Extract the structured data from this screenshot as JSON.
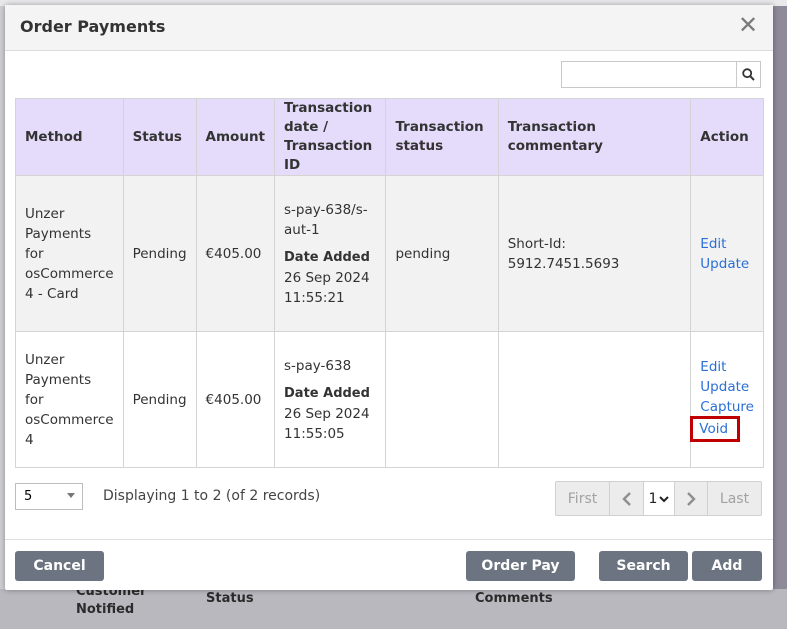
{
  "background": {
    "bottom_columns": [
      "Customer Notified",
      "Status",
      "Comments"
    ]
  },
  "modal": {
    "title": "Order Payments",
    "close_icon": "close-icon",
    "search": {
      "value": "",
      "placeholder": "",
      "icon": "search-icon"
    },
    "table": {
      "headers": [
        "Method",
        "Status",
        "Amount",
        "Transaction date / Transaction ID",
        "Transaction status",
        "Transaction commentary",
        "Action"
      ],
      "rows": [
        {
          "method": "Unzer Payments for osCommerce 4 - Card",
          "status": "Pending",
          "amount": "€405.00",
          "transaction_id": "s-pay-638/s-aut-1",
          "date_label": "Date Added",
          "date": "26 Sep 2024",
          "time": "11:55:21",
          "transaction_status": "pending",
          "commentary": "Short-Id: 5912.7451.5693",
          "actions": [
            "Edit",
            "Update"
          ]
        },
        {
          "method": "Unzer Payments for osCommerce 4",
          "status": "Pending",
          "amount": "€405.00",
          "transaction_id": "s-pay-638",
          "date_label": "Date Added",
          "date": "26 Sep 2024",
          "time": "11:55:05",
          "transaction_status": "",
          "commentary": "",
          "actions": [
            "Edit",
            "Update",
            "Capture",
            "Void"
          ]
        }
      ]
    },
    "pagination": {
      "per_page": "5",
      "displaying": "Displaying 1 to 2 (of 2 records)",
      "first": "First",
      "last": "Last",
      "current_page": "1"
    },
    "buttons": {
      "cancel": "Cancel",
      "order_pay": "Order Pay",
      "search": "Search",
      "add": "Add"
    },
    "colors": {
      "header_bg": "#e4dcfa",
      "link": "#2a6fd6",
      "highlight": "#c00000",
      "button_bg": "#6b7480"
    }
  }
}
